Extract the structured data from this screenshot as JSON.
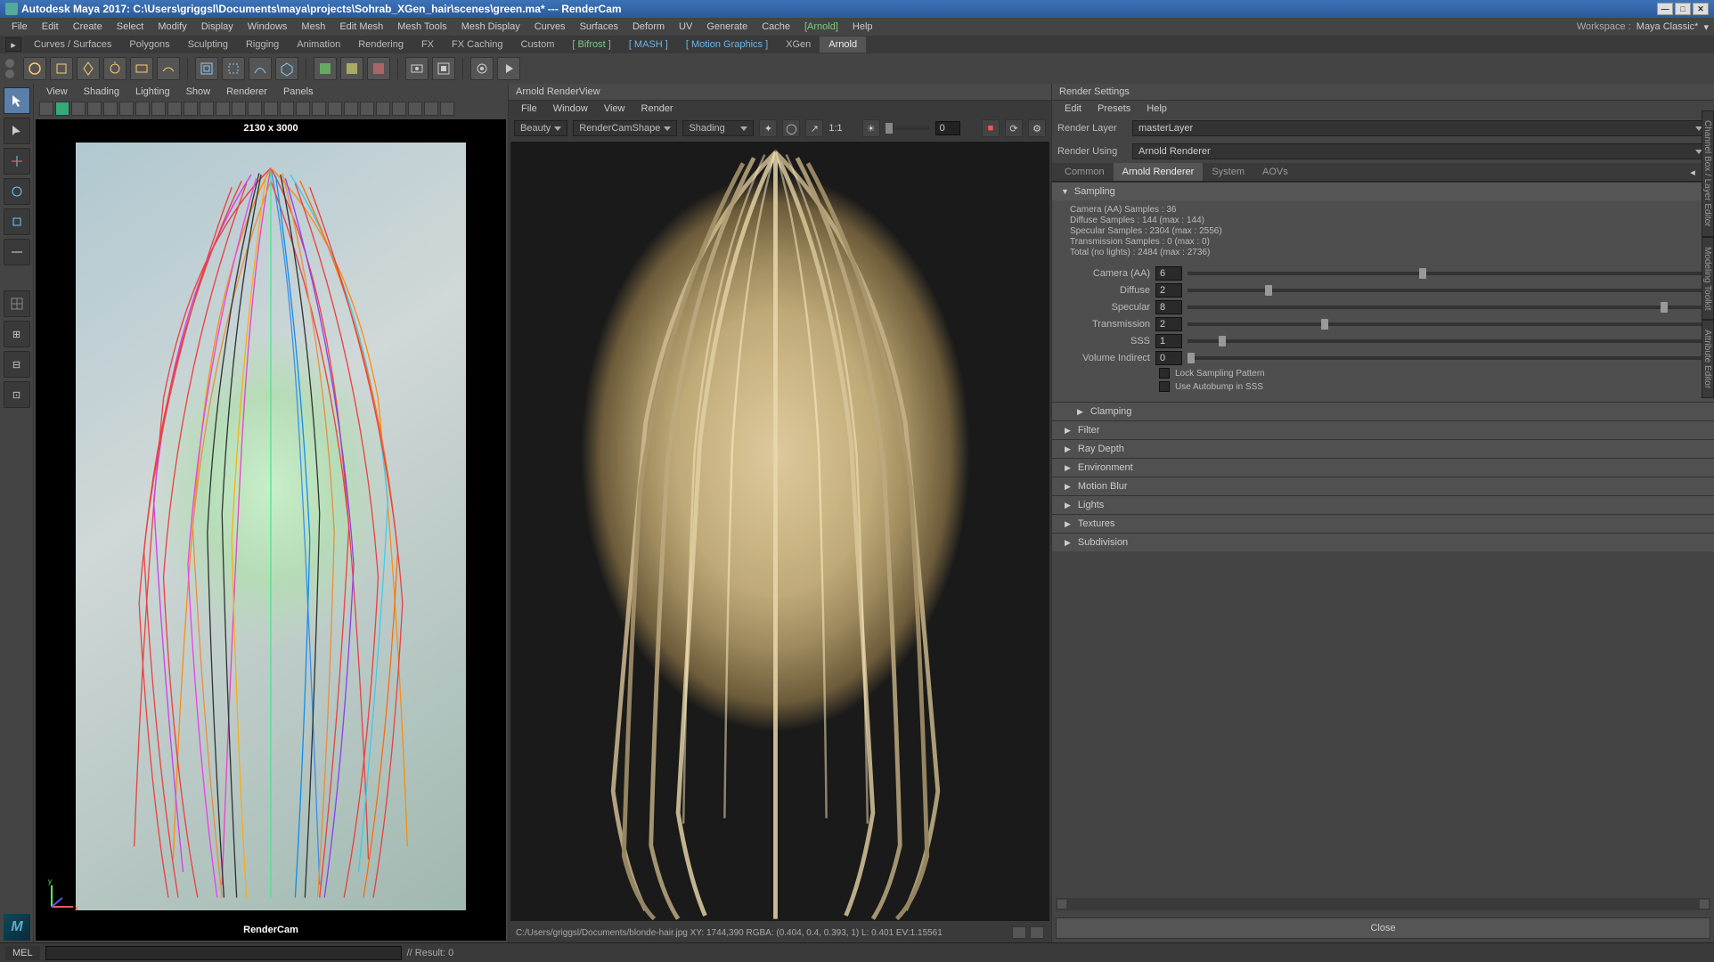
{
  "title": "Autodesk Maya 2017: C:\\Users\\griggsl\\Documents\\maya\\projects\\Sohrab_XGen_hair\\scenes\\green.ma*   ---   RenderCam",
  "menubar": [
    "File",
    "Edit",
    "Create",
    "Select",
    "Modify",
    "Display",
    "Windows",
    "Mesh",
    "Edit Mesh",
    "Mesh Tools",
    "Mesh Display",
    "Curves",
    "Surfaces",
    "Deform",
    "UV",
    "Generate",
    "Cache"
  ],
  "menubar_arnold": "[Arnold]",
  "menubar_help": "Help",
  "workspace_label": "Workspace :",
  "workspace_value": "Maya Classic*",
  "shelf_tabs": [
    "Curves / Surfaces",
    "Polygons",
    "Sculpting",
    "Rigging",
    "Animation",
    "Rendering",
    "FX",
    "FX Caching",
    "Custom"
  ],
  "shelf_bifrost": "[ Bifrost ]",
  "shelf_mash": "[ MASH ]",
  "shelf_motion": "[ Motion Graphics ]",
  "shelf_xgen": "XGen",
  "shelf_arnold": "Arnold",
  "viewport": {
    "menu": [
      "View",
      "Shading",
      "Lighting",
      "Show",
      "Renderer",
      "Panels"
    ],
    "resolution": "2130 x 3000",
    "camera": "RenderCam"
  },
  "renderview": {
    "title": "Arnold RenderView",
    "menu": [
      "File",
      "Window",
      "View",
      "Render"
    ],
    "dropdown1": "Beauty",
    "dropdown2": "RenderCamShape",
    "dropdown3": "Shading",
    "ratio": "1:1",
    "exposure": "0",
    "status": "C:/Users/griggsl/Documents/blonde-hair.jpg  XY: 1744,390   RGBA: (0.404, 0.4, 0.393, 1)        L: 0.401  EV:1.15561"
  },
  "settings": {
    "title": "Render Settings",
    "menu": [
      "Edit",
      "Presets",
      "Help"
    ],
    "layer_label": "Render Layer",
    "layer_value": "masterLayer",
    "using_label": "Render Using",
    "using_value": "Arnold Renderer",
    "tabs": [
      "Common",
      "Arnold Renderer",
      "System",
      "AOVs"
    ],
    "sampling_title": "Sampling",
    "info": [
      "Camera (AA) Samples : 36",
      "Diffuse Samples : 144 (max : 144)",
      "Specular Samples : 2304 (max : 2556)",
      "Transmission Samples : 0 (max : 0)",
      "Total (no lights) : 2484 (max : 2736)"
    ],
    "params": [
      {
        "label": "Camera (AA)",
        "value": "6",
        "pos": 45
      },
      {
        "label": "Diffuse",
        "value": "2",
        "pos": 15
      },
      {
        "label": "Specular",
        "value": "8",
        "pos": 92
      },
      {
        "label": "Transmission",
        "value": "2",
        "pos": 26
      },
      {
        "label": "SSS",
        "value": "1",
        "pos": 6
      },
      {
        "label": "Volume Indirect",
        "value": "0",
        "pos": 0
      }
    ],
    "chk1": "Lock Sampling Pattern",
    "chk2": "Use Autobump in SSS",
    "sections": [
      "Clamping",
      "Filter",
      "Ray Depth",
      "Environment",
      "Motion Blur",
      "Lights",
      "Textures",
      "Subdivision"
    ],
    "close": "Close"
  },
  "sidebar_tabs": [
    "Channel Box / Layer Editor",
    "Modeling Toolkit",
    "Attribute Editor"
  ],
  "cmdline": {
    "label": "MEL",
    "result": "// Result: 0"
  }
}
